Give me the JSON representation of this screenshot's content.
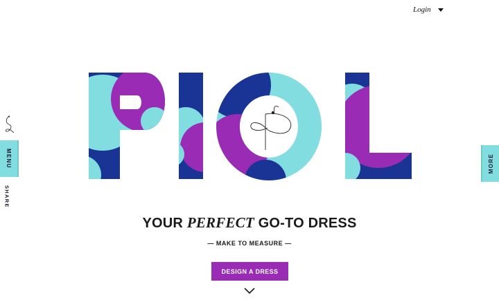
{
  "header": {
    "login_label": "Login"
  },
  "sidebar": {
    "menu_label": "MENU",
    "share_label": "SHARE"
  },
  "right_tab": {
    "more_label": "MORE"
  },
  "hero": {
    "brand_text": "PIOL",
    "colors": {
      "purple": "#9a2bb5",
      "navy": "#193494",
      "aqua": "#82dde1"
    }
  },
  "headline": {
    "before": "YOUR ",
    "emphasis": "PERFECT",
    "after": " GO-TO DRESS"
  },
  "subline": "— MAKE TO MEASURE —",
  "cta_label": "DESIGN A DRESS",
  "icons": {
    "dropdown": "chevron-down-icon",
    "scroll": "chevron-down-icon",
    "logo": "signature-logo-icon"
  }
}
